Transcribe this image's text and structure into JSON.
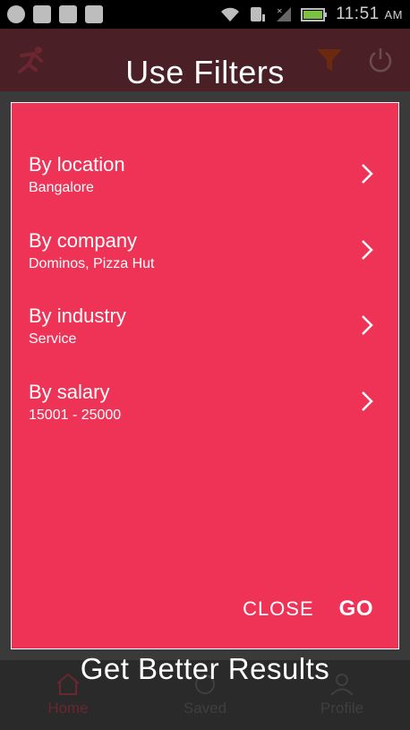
{
  "status_bar": {
    "time": "11:51",
    "ampm": "AM"
  },
  "overlay": {
    "title": "Use Filters",
    "subtitle": "Get Better Results"
  },
  "filters": [
    {
      "label": "By location",
      "value": "Bangalore"
    },
    {
      "label": "By company",
      "value": "Dominos, Pizza Hut"
    },
    {
      "label": "By industry",
      "value": "Service"
    },
    {
      "label": "By salary",
      "value": "15001 - 25000"
    }
  ],
  "actions": {
    "close_label": "CLOSE",
    "go_label": "GO"
  },
  "bottom_nav": {
    "items": [
      {
        "label": "Home",
        "icon": "home-icon"
      },
      {
        "label": "Saved",
        "icon": "saved-icon"
      },
      {
        "label": "Profile",
        "icon": "profile-icon"
      }
    ]
  },
  "colors": {
    "dialog_bg": "#ee3356",
    "appbar_bg": "#4a1f25",
    "text": "#ffffff"
  }
}
